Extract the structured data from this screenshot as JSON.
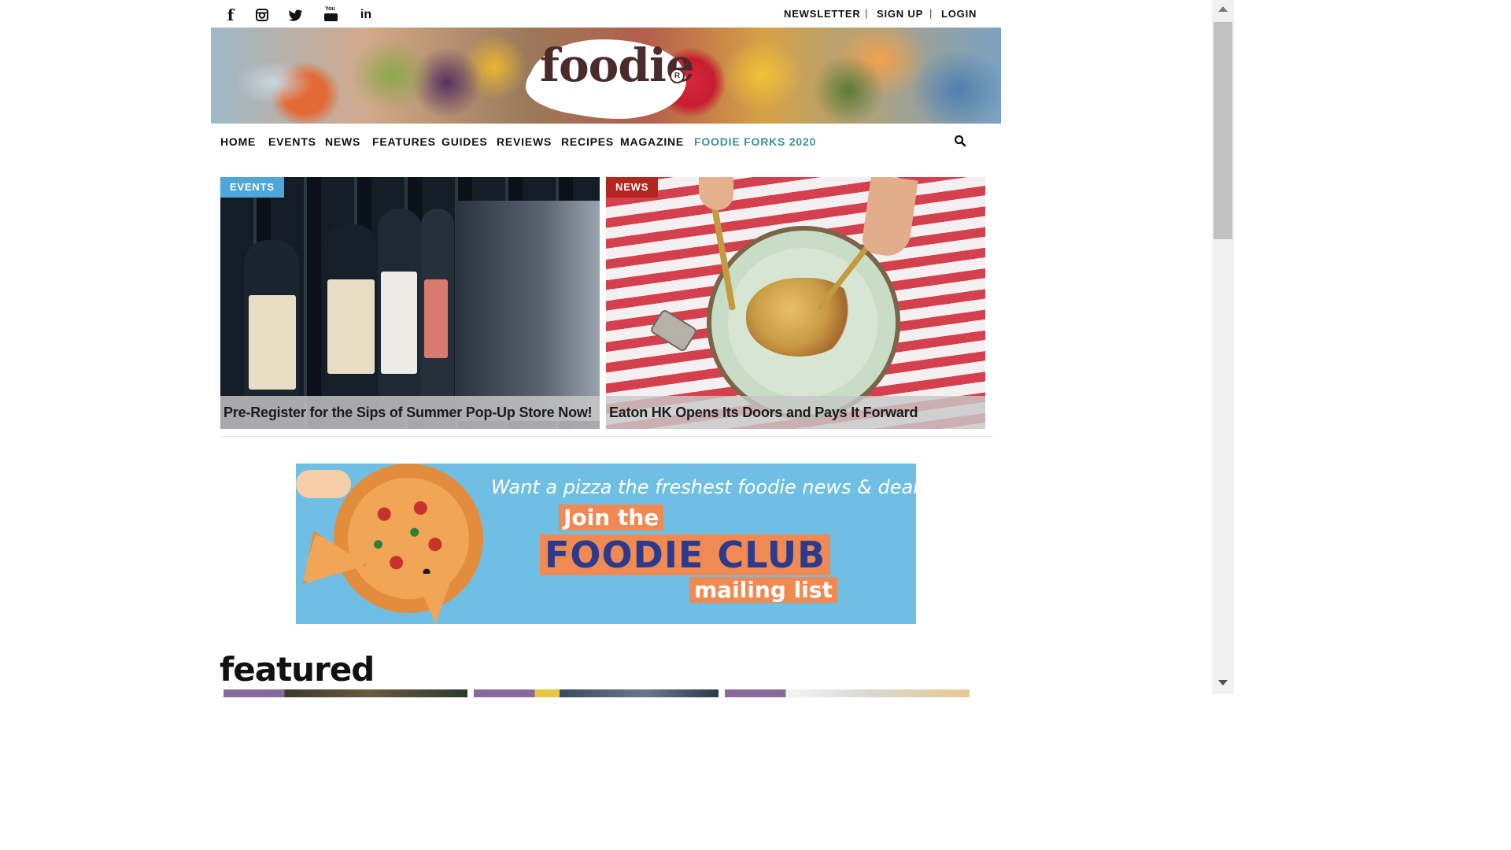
{
  "topbar": {
    "social_icons": [
      "facebook-icon",
      "instagram-icon",
      "twitter-icon",
      "youtube-icon",
      "linkedin-icon"
    ],
    "social_glyphs": {
      "facebook": "f",
      "linkedin": "in",
      "youtube": "You"
    },
    "links": {
      "newsletter": "NEWSLETTER",
      "signup": "SIGN UP",
      "login": "LOGIN"
    },
    "separator": "|"
  },
  "header": {
    "logo_text": "foodie",
    "logo_reg": "R"
  },
  "nav": {
    "items": [
      "HOME",
      "EVENTS",
      "NEWS",
      "FEATURES",
      "GUIDES",
      "REVIEWS",
      "RECIPES",
      "MAGAZINE",
      "FOODIE FORKS 2020"
    ],
    "accent_color": "#3e8f97"
  },
  "hero": {
    "cards": [
      {
        "tag": "EVENTS",
        "tag_color": "#4ea7d8",
        "title": "Pre-Register for the Sips of Summer Pop-Up Store Now!",
        "image": "wine-bottles-shelf"
      },
      {
        "tag": "NEWS",
        "tag_color": "#b3261f",
        "title": "Eaton HK Opens Its Doors and Pays It Forward",
        "image": "pasta-plate-striped-tablecloth"
      }
    ]
  },
  "ad": {
    "line1": "Want a pizza the freshest foodie news & deals?",
    "line2": "Join the",
    "line3": "FOODIE CLUB",
    "line4": "mailing list",
    "bg_color": "#6fbfe4",
    "accent_color": "#f08a52",
    "title_color": "#2b3a8c"
  },
  "featured": {
    "heading": "featured"
  },
  "colors": {
    "text": "#111111",
    "background": "#ffffff"
  }
}
